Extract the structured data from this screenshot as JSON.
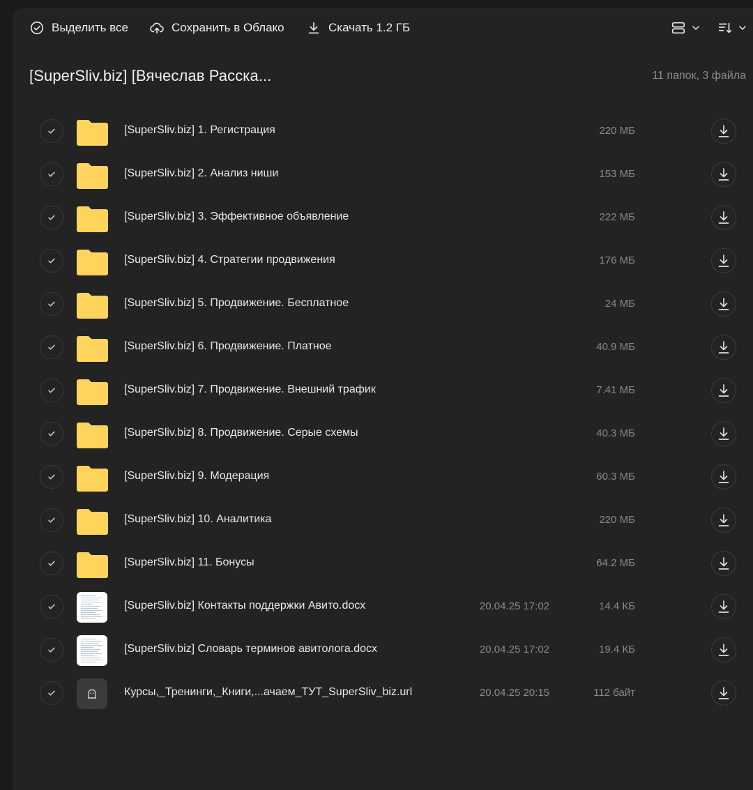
{
  "toolbar": {
    "select_all": "Выделить все",
    "save_cloud": "Сохранить в Облако",
    "download": "Скачать 1.2 ГБ"
  },
  "header": {
    "title": "[SuperSliv.biz] [Вячеслав Расска...",
    "count": "11 папок, 3 файла"
  },
  "colors": {
    "folder": "#fed45c",
    "panel": "#232323",
    "background": "#1b1b1b"
  },
  "items": [
    {
      "type": "folder",
      "name": "[SuperSliv.biz] 1. Регистрация",
      "date": "",
      "size": "220 МБ"
    },
    {
      "type": "folder",
      "name": "[SuperSliv.biz] 2. Анализ ниши",
      "date": "",
      "size": "153 МБ"
    },
    {
      "type": "folder",
      "name": "[SuperSliv.biz] 3. Эффективное объявление",
      "date": "",
      "size": "222 МБ"
    },
    {
      "type": "folder",
      "name": "[SuperSliv.biz] 4. Стратегии продвижения",
      "date": "",
      "size": "176 МБ"
    },
    {
      "type": "folder",
      "name": "[SuperSliv.biz] 5. Продвижение. Бесплатное",
      "date": "",
      "size": "24 МБ"
    },
    {
      "type": "folder",
      "name": "[SuperSliv.biz] 6. Продвижение. Платное",
      "date": "",
      "size": "40.9 МБ"
    },
    {
      "type": "folder",
      "name": "[SuperSliv.biz] 7. Продвижение. Внешний трафик",
      "date": "",
      "size": "7.41 МБ"
    },
    {
      "type": "folder",
      "name": "[SuperSliv.biz] 8. Продвижение. Серые схемы",
      "date": "",
      "size": "40.3 МБ"
    },
    {
      "type": "folder",
      "name": "[SuperSliv.biz] 9. Модерация",
      "date": "",
      "size": "60.3 МБ"
    },
    {
      "type": "folder",
      "name": "[SuperSliv.biz] 10. Аналитика",
      "date": "",
      "size": "220 МБ"
    },
    {
      "type": "folder",
      "name": "[SuperSliv.biz] 11. Бонусы",
      "date": "",
      "size": "64.2 МБ"
    },
    {
      "type": "doc",
      "name": "[SuperSliv.biz] Контакты поддержки Авито.docx",
      "date": "20.04.25 17:02",
      "size": "14.4 КБ"
    },
    {
      "type": "doc",
      "name": "[SuperSliv.biz] Словарь терминов авитолога.docx",
      "date": "20.04.25 17:02",
      "size": "19.4 КБ"
    },
    {
      "type": "url",
      "name": "Курсы,_Тренинги,_Книги,...ачаем_ТУТ_SuperSliv_biz.url",
      "date": "20.04.25 20:15",
      "size": "112 байт"
    }
  ]
}
